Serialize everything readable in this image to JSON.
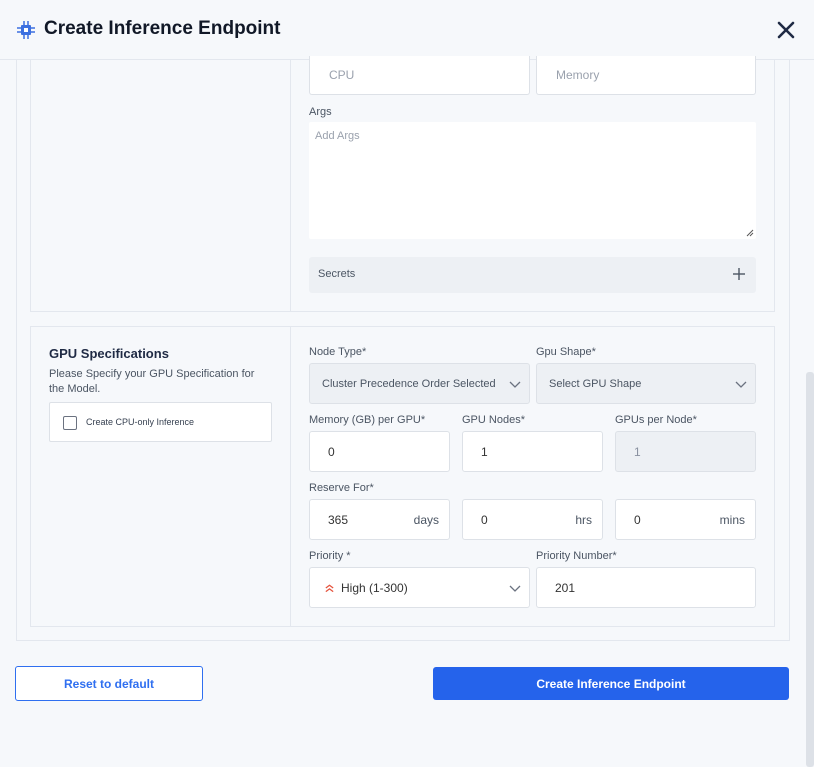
{
  "header": {
    "title": "Create Inference Endpoint",
    "icons": {
      "logo": "chip-icon",
      "close": "close-icon"
    }
  },
  "resources": {
    "cpu_placeholder": "CPU",
    "memory_placeholder": "Memory",
    "args_label": "Args",
    "args_placeholder": "Add Args",
    "secrets_label": "Secrets"
  },
  "gpu": {
    "title": "GPU Specifications",
    "description": "Please Specify your GPU Specification for the Model.",
    "cpu_only_label": "Create CPU-only Inference",
    "node_type_label": "Node Type*",
    "node_type_value": "Cluster Precedence Order Selected",
    "gpu_shape_label": "Gpu Shape*",
    "gpu_shape_placeholder": "Select GPU Shape",
    "memory_label": "Memory (GB) per GPU*",
    "memory_value": "0",
    "gpu_nodes_label": "GPU Nodes*",
    "gpu_nodes_value": "1",
    "gpus_per_node_label": "GPUs per Node*",
    "gpus_per_node_value": "1",
    "reserve_label": "Reserve For*",
    "reserve_days_value": "365",
    "reserve_days_unit": "days",
    "reserve_hrs_value": "0",
    "reserve_hrs_unit": "hrs",
    "reserve_mins_value": "0",
    "reserve_mins_unit": "mins",
    "priority_label": "Priority *",
    "priority_value": "High (1-300)",
    "priority_number_label": "Priority Number*",
    "priority_number_value": "201"
  },
  "footer": {
    "reset_label": "Reset to default",
    "create_label": "Create Inference Endpoint"
  },
  "colors": {
    "primary": "#2563eb",
    "priority_high": "#e5533d"
  }
}
